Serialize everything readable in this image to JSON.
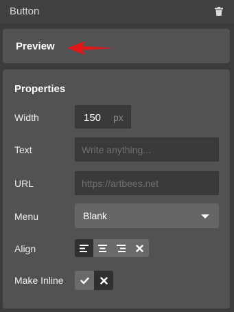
{
  "topbar": {
    "title": "Button",
    "trash_icon": "trash-icon"
  },
  "preview": {
    "label": "Preview",
    "arrow_color": "#e01818"
  },
  "properties": {
    "heading": "Properties",
    "width": {
      "label": "Width",
      "value": "150",
      "unit": "px"
    },
    "text": {
      "label": "Text",
      "placeholder": "Write anything..."
    },
    "url": {
      "label": "URL",
      "placeholder": "https://artbees.net"
    },
    "menu": {
      "label": "Menu",
      "value": "Blank"
    },
    "align": {
      "label": "Align",
      "options": [
        "align-left-icon",
        "align-center-icon",
        "align-right-icon",
        "close-icon"
      ],
      "selected": "align-left-icon"
    },
    "make_inline": {
      "label": "Make Inline",
      "options": [
        "check-icon",
        "close-icon"
      ],
      "selected": "close-icon"
    }
  }
}
